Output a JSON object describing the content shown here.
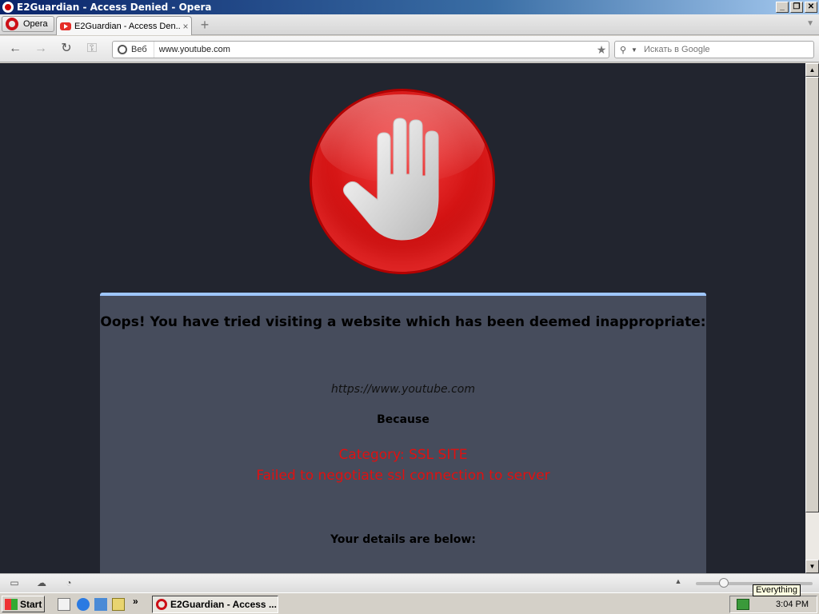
{
  "window": {
    "title": "E2Guardian - Access Denied - Opera"
  },
  "window_controls": {
    "minimize": "_",
    "restore": "❐",
    "close": "✕"
  },
  "tabbar": {
    "menu_label": "Opera",
    "tabs": [
      {
        "label": "E2Guardian - Access Den...",
        "close": "×"
      }
    ],
    "new_tab": "+",
    "scroll": "▼"
  },
  "navbar": {
    "back": "←",
    "forward": "→",
    "reload": "↻",
    "key": "⚿",
    "web_badge": "Веб",
    "url": "www.youtube.com",
    "star": "★",
    "search_icon": "⚲",
    "search_dropdown": "▼",
    "search_placeholder": "Искать в Google"
  },
  "page": {
    "heading": "Oops! You have tried visiting a website which has been deemed inappropriate:",
    "blocked_url": "https://www.youtube.com",
    "because": "Because",
    "reason_category": "Category: SSL SITE",
    "reason_detail": "Failed to negotiate ssl connection to server",
    "details": "Your details are below:"
  },
  "statusbar": {
    "tooltip": "Everything",
    "zoom_level": 0.24,
    "arrow_up": "▲"
  },
  "scrollbar": {
    "up": "▲",
    "down": "▼"
  },
  "taskbar": {
    "start_label": "Start",
    "quicklaunch_more": "»",
    "task_label": "E2Guardian - Access ...",
    "clock": "3:04 PM"
  },
  "colors": {
    "page_bg": "#22252f",
    "panel_bg": "#464c5c",
    "panel_top_border": "#9fc7ff",
    "reason_text": "#e01010",
    "stop_red": "#d41414"
  }
}
